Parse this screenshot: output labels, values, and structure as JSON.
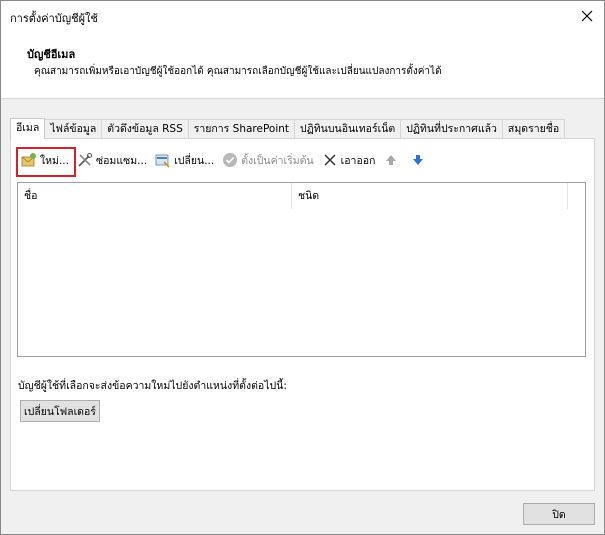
{
  "window": {
    "title": "การตั้งค่าบัญชีผู้ใช้"
  },
  "header": {
    "title": "บัญชีอีเมล",
    "description": "คุณสามารถเพิ่มหรือเอาบัญชีผู้ใช้ออกได้ คุณสามารถเลือกบัญชีผู้ใช้และเปลี่ยนแปลงการตั้งค่าได้"
  },
  "tabs": [
    {
      "label": "อีเมล",
      "active": true
    },
    {
      "label": "ไฟล์ข้อมูล"
    },
    {
      "label": "ตัวดึงข้อมูล RSS"
    },
    {
      "label": "รายการ SharePoint"
    },
    {
      "label": "ปฏิทินบนอินเทอร์เน็ต"
    },
    {
      "label": "ปฏิทินที่ประกาศแล้ว"
    },
    {
      "label": "สมุดรายชื่อ"
    }
  ],
  "toolbar": {
    "new_label": "ใหม่...",
    "repair_label": "ซ่อมแซม...",
    "change_label": "เปลี่ยน...",
    "default_label": "ตั้งเป็นค่าเริ่มต้น",
    "remove_label": "เอาออก"
  },
  "list": {
    "col_name": "ชื่อ",
    "col_type": "ชนิด"
  },
  "footer": {
    "path_text": "บัญชีผู้ใช้ที่เลือกจะส่งข้อความใหม่ไปยังตำแหน่งที่ตั้งต่อไปนี้:",
    "change_folder_label": "เปลี่ยนโฟลเดอร์",
    "close_label": "ปิด"
  },
  "colors": {
    "highlight": "#d2232a",
    "arrow_down": "#2e6fd8",
    "arrow_up": "#a8a8a8"
  }
}
